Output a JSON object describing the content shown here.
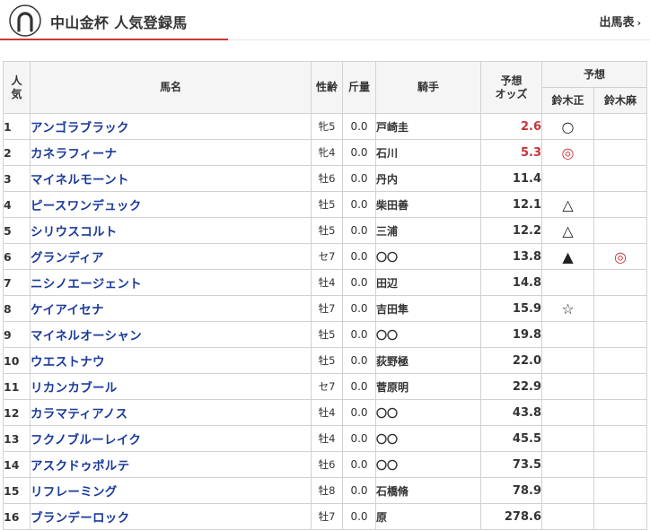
{
  "header": {
    "title": "中山金杯 人気登録馬",
    "entries_link": "出馬表"
  },
  "colors": {
    "accent": "#d03434",
    "link": "#1a3a9c",
    "odds_hot": "#c8343a"
  },
  "table": {
    "headers": {
      "rank": "人\n気",
      "horse": "馬名",
      "sex_age": "性齢",
      "weight": "斤量",
      "jockey": "騎手",
      "odds": "予想\nオッズ",
      "yoso": "予想",
      "yoso_sub": [
        "鈴木正",
        "鈴木麻"
      ]
    },
    "rows": [
      {
        "rank": "1",
        "horse": "アンゴラブラック",
        "sex_age": "牝5",
        "weight": "0.0",
        "jockey": "戸崎圭",
        "odds": "2.6",
        "mark1": "○",
        "mark2": ""
      },
      {
        "rank": "2",
        "horse": "カネラフィーナ",
        "sex_age": "牝4",
        "weight": "0.0",
        "jockey": "石川",
        "odds": "5.3",
        "mark1": "◎",
        "mark2": ""
      },
      {
        "rank": "3",
        "horse": "マイネルモーント",
        "sex_age": "牡6",
        "weight": "0.0",
        "jockey": "丹内",
        "odds": "11.4",
        "mark1": "",
        "mark2": ""
      },
      {
        "rank": "4",
        "horse": "ピースワンデュック",
        "sex_age": "牡5",
        "weight": "0.0",
        "jockey": "柴田善",
        "odds": "12.1",
        "mark1": "△",
        "mark2": ""
      },
      {
        "rank": "5",
        "horse": "シリウスコルト",
        "sex_age": "牡5",
        "weight": "0.0",
        "jockey": "三浦",
        "odds": "12.2",
        "mark1": "△",
        "mark2": ""
      },
      {
        "rank": "6",
        "horse": "グランディア",
        "sex_age": "セ7",
        "weight": "0.0",
        "jockey": "〇〇",
        "odds": "13.8",
        "mark1": "▲",
        "mark2": "◎"
      },
      {
        "rank": "7",
        "horse": "ニシノエージェント",
        "sex_age": "牡4",
        "weight": "0.0",
        "jockey": "田辺",
        "odds": "14.8",
        "mark1": "",
        "mark2": ""
      },
      {
        "rank": "8",
        "horse": "ケイアイセナ",
        "sex_age": "牡7",
        "weight": "0.0",
        "jockey": "吉田隼",
        "odds": "15.9",
        "mark1": "☆",
        "mark2": ""
      },
      {
        "rank": "9",
        "horse": "マイネルオーシャン",
        "sex_age": "牡5",
        "weight": "0.0",
        "jockey": "〇〇",
        "odds": "19.8",
        "mark1": "",
        "mark2": ""
      },
      {
        "rank": "10",
        "horse": "ウエストナウ",
        "sex_age": "牡5",
        "weight": "0.0",
        "jockey": "荻野極",
        "odds": "22.0",
        "mark1": "",
        "mark2": ""
      },
      {
        "rank": "11",
        "horse": "リカンカブール",
        "sex_age": "セ7",
        "weight": "0.0",
        "jockey": "菅原明",
        "odds": "22.9",
        "mark1": "",
        "mark2": ""
      },
      {
        "rank": "12",
        "horse": "カラマティアノス",
        "sex_age": "牡4",
        "weight": "0.0",
        "jockey": "〇〇",
        "odds": "43.8",
        "mark1": "",
        "mark2": ""
      },
      {
        "rank": "13",
        "horse": "フクノブルーレイク",
        "sex_age": "牡4",
        "weight": "0.0",
        "jockey": "〇〇",
        "odds": "45.5",
        "mark1": "",
        "mark2": ""
      },
      {
        "rank": "14",
        "horse": "アスクドゥポルテ",
        "sex_age": "牡6",
        "weight": "0.0",
        "jockey": "〇〇",
        "odds": "73.5",
        "mark1": "",
        "mark2": ""
      },
      {
        "rank": "15",
        "horse": "リフレーミング",
        "sex_age": "牡8",
        "weight": "0.0",
        "jockey": "石橋脩",
        "odds": "78.9",
        "mark1": "",
        "mark2": ""
      },
      {
        "rank": "16",
        "horse": "ブランデーロック",
        "sex_age": "牡7",
        "weight": "0.0",
        "jockey": "原",
        "odds": "278.6",
        "mark1": "",
        "mark2": ""
      }
    ]
  }
}
